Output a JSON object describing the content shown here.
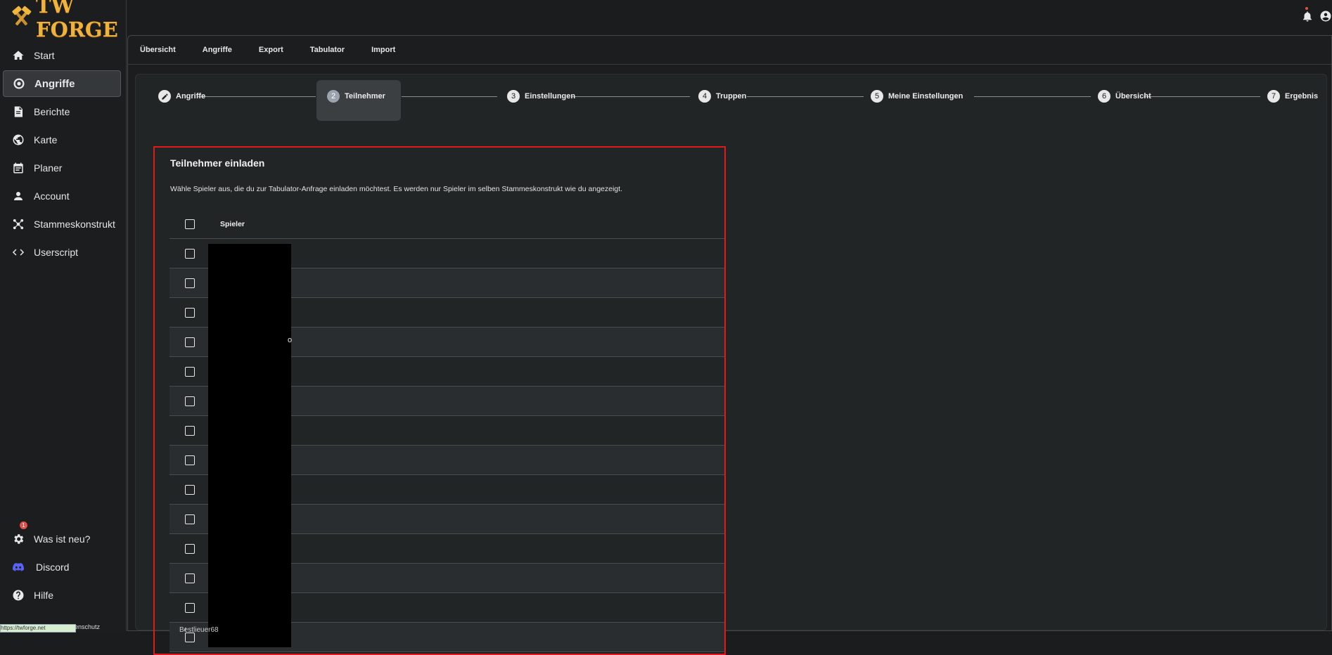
{
  "app": {
    "name": "TW FORGE"
  },
  "sidebar": {
    "items": [
      {
        "label": "Start",
        "icon": "home-icon"
      },
      {
        "label": "Angriffe",
        "icon": "target-icon",
        "active": true
      },
      {
        "label": "Berichte",
        "icon": "document-icon"
      },
      {
        "label": "Karte",
        "icon": "globe-icon"
      },
      {
        "label": "Planer",
        "icon": "calendar-icon"
      },
      {
        "label": "Account",
        "icon": "person-icon"
      },
      {
        "label": "Stammeskonstrukt",
        "icon": "network-icon"
      },
      {
        "label": "Userscript",
        "icon": "code-icon"
      }
    ],
    "bottom": [
      {
        "label": "Was ist neu?",
        "icon": "gear-icon",
        "badge": "1"
      },
      {
        "label": "Discord",
        "icon": "discord-icon"
      },
      {
        "label": "Hilfe",
        "icon": "help-icon"
      }
    ]
  },
  "tabs": [
    "Übersicht",
    "Angriffe",
    "Export",
    "Tabulator",
    "Import"
  ],
  "stepper": {
    "steps": [
      {
        "num": "",
        "label": "Angriffe",
        "icon": "pencil-icon"
      },
      {
        "num": "2",
        "label": "Teilnehmer",
        "active": true
      },
      {
        "num": "3",
        "label": "Einstellungen"
      },
      {
        "num": "4",
        "label": "Truppen"
      },
      {
        "num": "5",
        "label": "Meine Einstellungen"
      },
      {
        "num": "6",
        "label": "Übersicht"
      },
      {
        "num": "7",
        "label": "Ergebnis"
      }
    ]
  },
  "invite": {
    "title": "Teilnehmer einladen",
    "description": "Wähle Spieler aus, die du zur Tabulator-Anfrage einladen möchtest. Es werden nur Spieler im selben Stammeskonstrukt wie du angezeigt.",
    "column_header": "Spieler",
    "row_count": 14,
    "visible_fragment": "o",
    "next_row_partial": "Bestlieuer68"
  },
  "statusbar": {
    "url": "https://twforge.net",
    "extra": "enschutz"
  },
  "colors": {
    "accent": "#f0b23a",
    "highlight_border": "#e01b1b",
    "badge": "#e2504a"
  }
}
